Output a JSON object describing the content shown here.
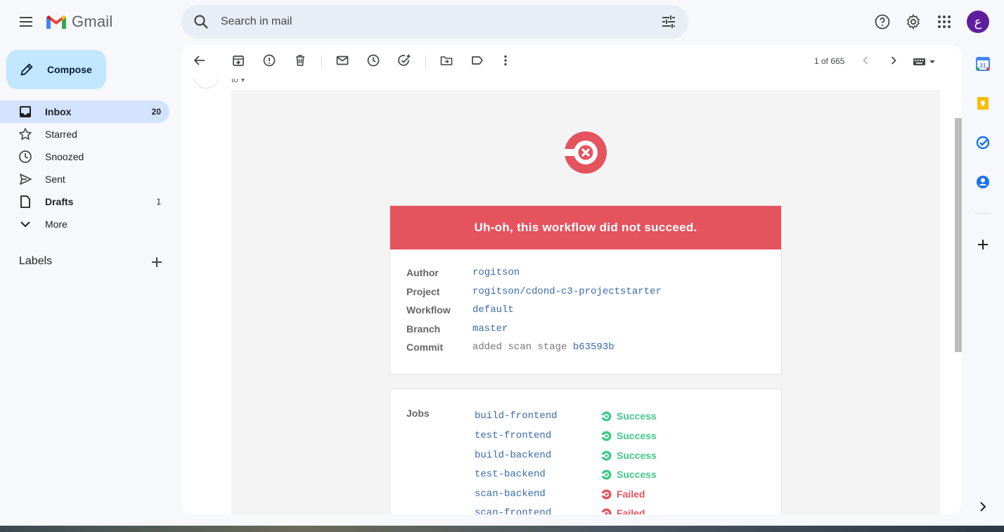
{
  "app": {
    "name": "Gmail"
  },
  "search": {
    "placeholder": "Search in mail"
  },
  "user": {
    "avatar_letter": "ع"
  },
  "compose": {
    "label": "Compose"
  },
  "sidebar": {
    "items": [
      {
        "label": "Inbox",
        "count": "20"
      },
      {
        "label": "Starred",
        "count": ""
      },
      {
        "label": "Snoozed",
        "count": ""
      },
      {
        "label": "Sent",
        "count": ""
      },
      {
        "label": "Drafts",
        "count": "1"
      },
      {
        "label": "More",
        "count": ""
      }
    ],
    "labels_heading": "Labels"
  },
  "toolbar": {
    "pager": "1 of 665"
  },
  "message": {
    "to_label": "to",
    "banner": "Uh-oh, this workflow did not succeed.",
    "details": {
      "author_key": "Author",
      "author": "rogitson",
      "project_key": "Project",
      "project": "rogitson/cdond-c3-projectstarter",
      "workflow_key": "Workflow",
      "workflow": "default",
      "branch_key": "Branch",
      "branch": "master",
      "commit_key": "Commit",
      "commit_msg": "added scan stage",
      "commit_hash": "b63593b"
    },
    "jobs_label": "Jobs",
    "jobs": [
      {
        "name": "build-frontend",
        "status": "Success"
      },
      {
        "name": "test-frontend",
        "status": "Success"
      },
      {
        "name": "build-backend",
        "status": "Success"
      },
      {
        "name": "test-backend",
        "status": "Success"
      },
      {
        "name": "scan-backend",
        "status": "Failed"
      },
      {
        "name": "scan-frontend",
        "status": "Failed"
      }
    ]
  },
  "colors": {
    "fail": "#e5535f",
    "success": "#42c88a",
    "link": "#396bab",
    "accent": "#c2e7ff"
  },
  "icons": [
    "menu-icon",
    "search-icon",
    "tune-icon",
    "help-icon",
    "settings-icon",
    "apps-icon",
    "pencil-icon",
    "inbox-icon",
    "star-icon",
    "clock-icon",
    "send-icon",
    "draft-icon",
    "chevron-down-icon",
    "plus-icon",
    "back-arrow-icon",
    "archive-icon",
    "report-spam-icon",
    "trash-icon",
    "mark-unread-icon",
    "snooze-icon",
    "add-task-icon",
    "move-to-icon",
    "label-icon",
    "more-vert-icon",
    "chevron-left-icon",
    "chevron-right-icon",
    "keyboard-icon",
    "calendar-icon",
    "keep-icon",
    "tasks-icon",
    "contacts-icon",
    "circleci-fail-icon",
    "success-icon",
    "failed-icon"
  ]
}
